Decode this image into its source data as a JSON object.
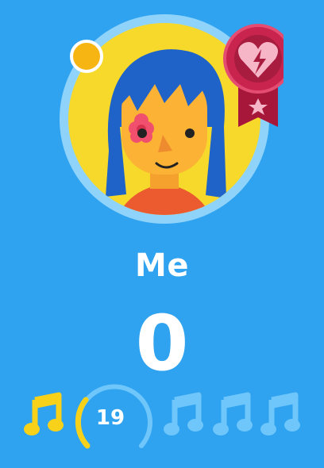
{
  "player": {
    "name": "Me",
    "score": "0"
  },
  "round": {
    "timer": "19",
    "timer_fraction": 0.35,
    "notes_total": 4,
    "notes_earned": 1
  },
  "colors": {
    "background": "#2fa3ef",
    "note_active": "#f8d11a",
    "note_inactive": "#6fc6fb",
    "badge": "#c8244e"
  },
  "icons": {
    "status_dot": "online-dot-icon",
    "badge": "heart-bolt-badge-icon",
    "note": "music-note-icon"
  }
}
